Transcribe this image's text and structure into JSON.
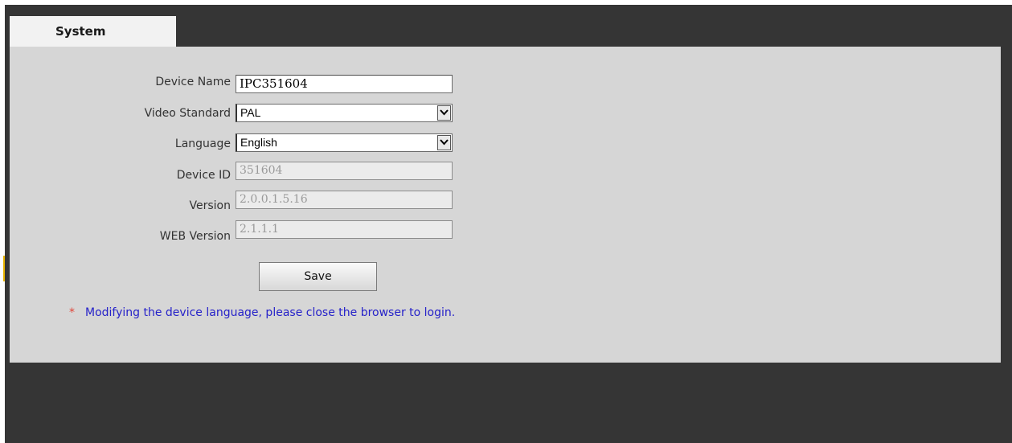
{
  "tab": {
    "label": "System"
  },
  "form": {
    "device_name": {
      "label": "Device Name",
      "value": "IPC351604"
    },
    "video_standard": {
      "label": "Video Standard",
      "value": "PAL"
    },
    "language": {
      "label": "Language",
      "value": "English"
    },
    "device_id": {
      "label": "Device ID",
      "value": "351604"
    },
    "version": {
      "label": "Version",
      "value": "2.0.0.1.5.16"
    },
    "web_version": {
      "label": "WEB Version",
      "value": "2.1.1.1"
    }
  },
  "save_button": {
    "label": "Save"
  },
  "note": {
    "marker": "*",
    "text": "Modifying the device language, please close the browser to login."
  },
  "colors": {
    "frame": "#353535",
    "panel": "#d6d6d6",
    "tab": "#f2f2f2",
    "note_text": "#2622c9",
    "note_marker": "#e0463a"
  },
  "icons": {
    "select_arrow": "chevron-down-icon"
  }
}
